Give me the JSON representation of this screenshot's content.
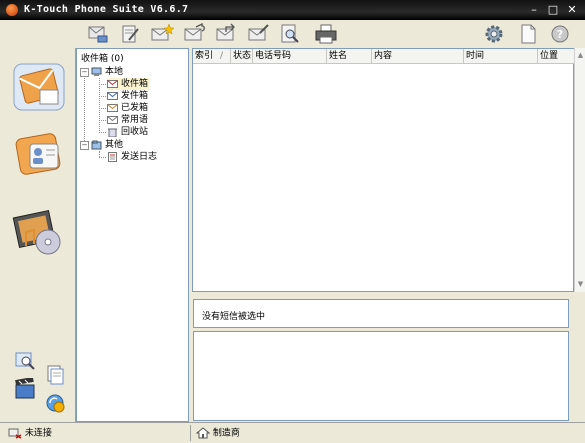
{
  "window": {
    "title": "K-Touch Phone Suite V6.6.7"
  },
  "toolbar": {
    "buttons": [
      {
        "name": "read-icon"
      },
      {
        "name": "edit-icon"
      },
      {
        "name": "new-message-icon"
      },
      {
        "name": "reply-icon"
      },
      {
        "name": "forward-icon"
      },
      {
        "name": "sign-icon"
      },
      {
        "name": "find-icon"
      },
      {
        "name": "print-icon"
      },
      {
        "name": "settings-icon"
      },
      {
        "name": "document-icon"
      },
      {
        "name": "help-icon"
      }
    ]
  },
  "tree": {
    "header": "收件箱 (0)",
    "local_label": "本地",
    "local_items": [
      "收件箱",
      "发件箱",
      "已发箱",
      "常用语",
      "回收站"
    ],
    "other_label": "其他",
    "other_items": [
      "发送日志"
    ]
  },
  "grid": {
    "columns": [
      "索引",
      "/",
      "状态",
      "电话号码",
      "姓名",
      "内容",
      "时间",
      "位置"
    ]
  },
  "message_panel": {
    "text": "没有短信被选中"
  },
  "statusbar": {
    "connection": "未连接",
    "manufacturer": "制造商"
  },
  "colors": {
    "titlebar": "#000000",
    "selection": "#fbf3d0",
    "border": "#7f9db9"
  }
}
